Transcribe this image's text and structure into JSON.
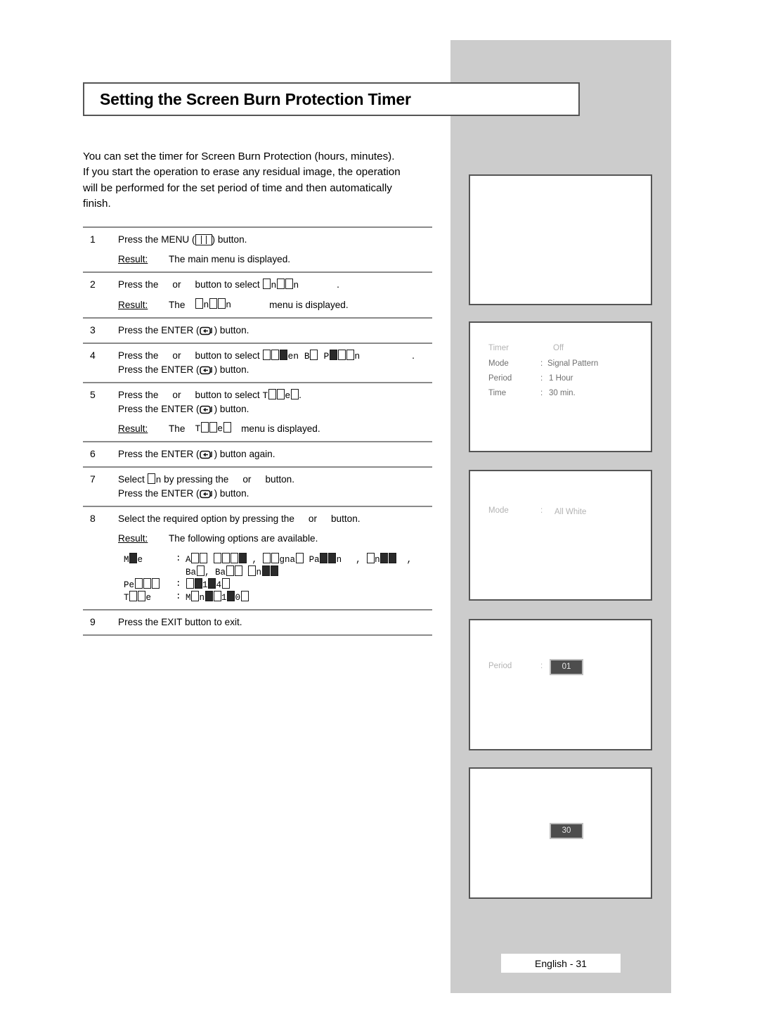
{
  "page": {
    "title": "Setting the Screen Burn Protection Timer",
    "footer": "English - 31"
  },
  "intro": {
    "line1": "You can set the timer for Screen Burn Protection (hours, minutes).",
    "line2": "If you start the operation to erase any residual image, the operation",
    "line3": "will be performed for the set period of time and then automatically",
    "line4": "finish."
  },
  "labels": {
    "result": "Result:",
    "press_the": "Press the",
    "or": "or",
    "button_to_select": "button to select",
    "button_period": "button.",
    "the": "The"
  },
  "steps": [
    {
      "num": "1",
      "line_a_pre": "Press the MENU (",
      "line_a_post": ") button.",
      "result": "The main menu is displayed.",
      "icon": "menu-icon"
    },
    {
      "num": "2",
      "pre": "Press the",
      "mid": "or",
      "post": "button to select",
      "target": "Function",
      "tail": ".",
      "result_pre": "The",
      "result_target": "Function",
      "result_post": "menu is displayed."
    },
    {
      "num": "3",
      "line_a_pre": "Press the ENTER (",
      "line_a_post": ") button.",
      "icon": "enter-icon"
    },
    {
      "num": "4",
      "pre": "Press the",
      "mid": "or",
      "post": "button to select",
      "target": "Screen Burn Protection",
      "tail": ".",
      "line_b_pre": "Press the ENTER (",
      "line_b_post": ") button."
    },
    {
      "num": "5",
      "pre": "Press the",
      "mid": "or",
      "post": "button to select",
      "target": "Timer",
      "tail": ".",
      "line_b_pre": "Press the ENTER (",
      "line_b_post": ") button.",
      "result_pre": "The",
      "result_target": "Timer",
      "result_post": "menu is displayed."
    },
    {
      "num": "6",
      "line_a_pre": "Press the ENTER (",
      "line_a_post": ") button again."
    },
    {
      "num": "7",
      "pre": "Select",
      "target": "On",
      "post_a": "by pressing the",
      "mid": "or",
      "post_b": "button.",
      "line_b_pre": "Press the ENTER (",
      "line_b_post": ") button."
    },
    {
      "num": "8",
      "line_a_pre": "Select the required option by pressing the",
      "mid": "or",
      "line_a_post": "button.",
      "result": "The following options are available."
    },
    {
      "num": "9",
      "line_a": "Press the EXIT button to exit."
    }
  ],
  "options": [
    {
      "key": "Mode",
      "value_line1": "All White , Signal Pattern , Scroll ,",
      "value_line2": "Bar, Bar Scroll"
    },
    {
      "key": "Period",
      "value_line1": "1~24 Hour"
    },
    {
      "key": "Time",
      "value_line1": "Minute 10~50"
    }
  ],
  "panels": [
    {
      "name": "panel-blank",
      "rows": []
    },
    {
      "name": "panel-timer-menu",
      "rows": [
        {
          "label": "Timer",
          "colon": "",
          "value": "Off"
        },
        {
          "label": "Mode",
          "colon": ":",
          "value": "Signal Pattern"
        },
        {
          "label": "Period",
          "colon": ":",
          "value": "1   Hour"
        },
        {
          "label": "Time",
          "colon": ":",
          "value": "30 min."
        }
      ]
    },
    {
      "name": "panel-mode-select",
      "rows": [
        {
          "label": "Mode",
          "colon": ":",
          "value": "All White"
        }
      ]
    },
    {
      "name": "panel-period-select",
      "rows": [
        {
          "label": "Period",
          "colon": ":",
          "value": "01",
          "highlight": true
        }
      ]
    },
    {
      "name": "panel-time-select",
      "rows": [
        {
          "label": "",
          "colon": "",
          "value": "30",
          "highlight": true
        }
      ]
    }
  ],
  "colors": {
    "sidebar": "#cccccc",
    "rule": "#8a8a8a",
    "panel_border": "#555555",
    "osd_text": "#b3b3b3",
    "highlight_bg": "#4d4d4d"
  }
}
